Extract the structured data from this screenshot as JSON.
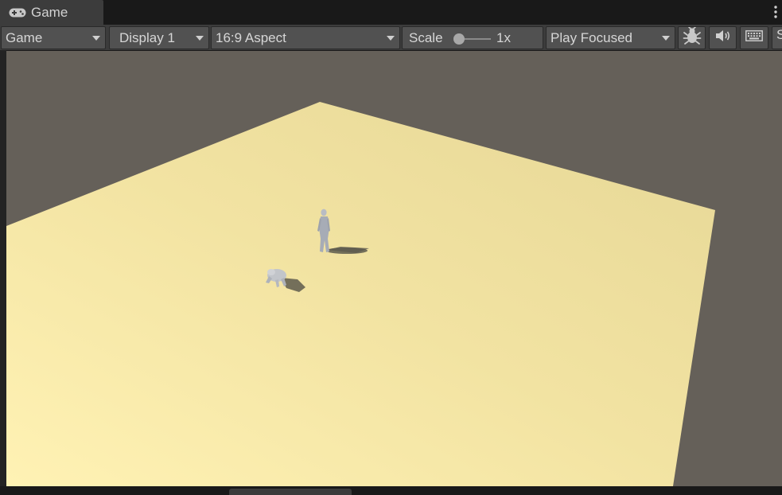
{
  "tab": {
    "title": "Game",
    "icon": "gamepad-icon"
  },
  "toolbar": {
    "mode": "Game",
    "display": "Display 1",
    "aspect": "16:9 Aspect",
    "scale_label": "Scale",
    "scale_value": "1x",
    "play_mode": "Play Focused",
    "truncated_label": "S",
    "icons": [
      "bug-icon",
      "speaker-icon",
      "keyboard-icon"
    ]
  },
  "colors": {
    "panel": "#3c3c3c",
    "control": "#515151",
    "background": "#191919",
    "sky": "#656059",
    "ground": "#f5e6a3"
  }
}
